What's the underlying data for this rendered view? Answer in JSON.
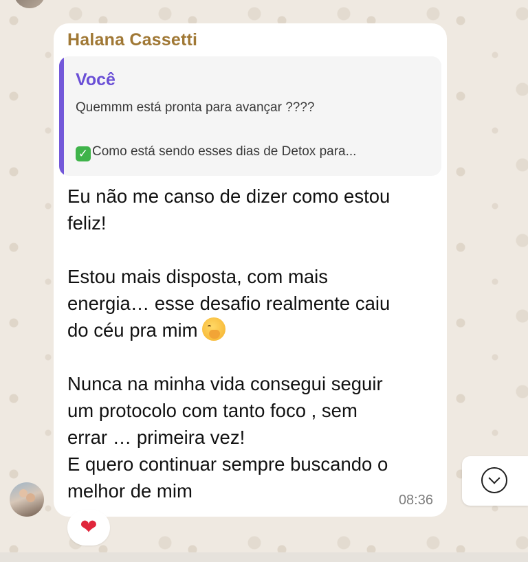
{
  "message": {
    "sender": "Halana Cassetti",
    "quoted": {
      "author": "Você",
      "line1": "Quemmm está pronta para avançar ????",
      "line2": "Como está sendo esses dias de Detox para..."
    },
    "body_part1": "Eu não me canso de dizer como estou\nfeliz!\n\nEstou mais disposta, com mais\nenergia… esse desafio realmente caiu\ndo céu pra mim",
    "body_part2": "\n\nNunca na minha vida consegui seguir\num protocolo com tanto foco , sem\nerrar … primeira vez!\nE quero continuar sempre buscando o\nmelhor de mim",
    "time": "08:36",
    "emoji": "face-with-hand-over-mouth-icon",
    "reaction": "❤"
  },
  "icons": {
    "quote_check": "check-mark-button-icon",
    "scroll": "chevron-down-circle-icon"
  },
  "colors": {
    "sender_name": "#a07835",
    "quote_author": "#6a4fd6",
    "quote_bar": "#7358d9",
    "reaction_heart": "#e0263b",
    "bubble": "#ffffff",
    "wallpaper": "#efe9e1"
  }
}
